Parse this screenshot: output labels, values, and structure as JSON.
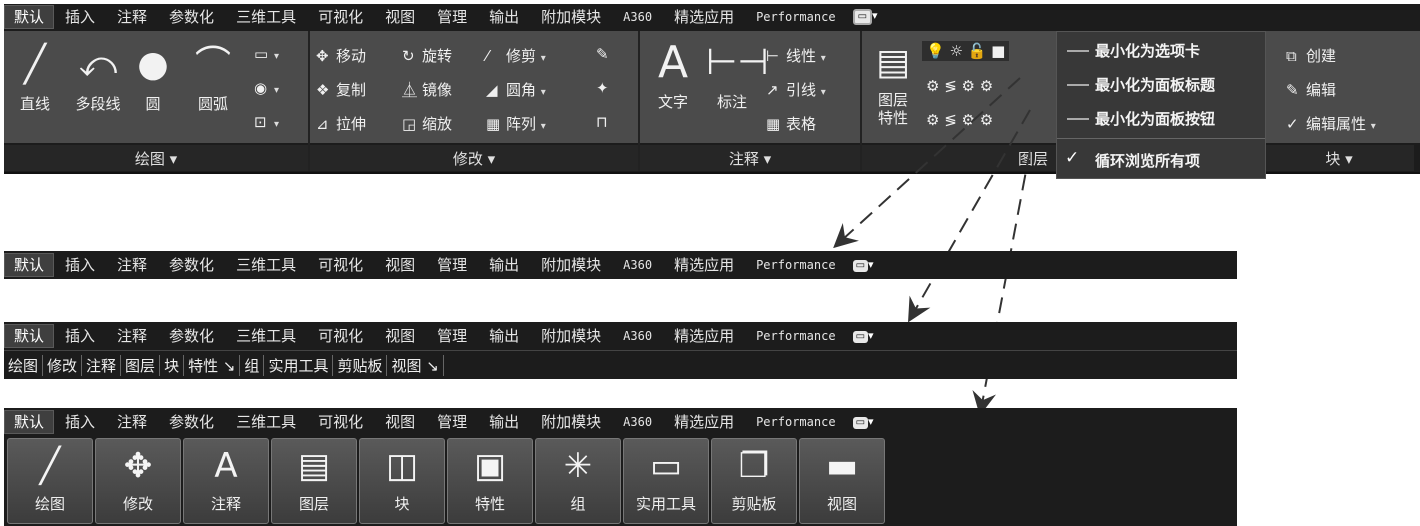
{
  "tabs": [
    "默认",
    "插入",
    "注释",
    "参数化",
    "三维工具",
    "可视化",
    "视图",
    "管理",
    "输出",
    "附加模块",
    "A360",
    "精选应用",
    "Performance"
  ],
  "menu_items": [
    "最小化为选项卡",
    "最小化为面板标题",
    "最小化为面板按钮",
    "循环浏览所有项"
  ],
  "menu_checked_icon": "✓",
  "draw": {
    "title": "绘图 ▾",
    "line": "直线",
    "polyline": "多段线",
    "circle": "圆",
    "arc": "圆弧"
  },
  "modify": {
    "title": "修改 ▾",
    "move": "移动",
    "rotate": "旋转",
    "trim": "修剪",
    "copy": "复制",
    "mirror": "镜像",
    "fillet": "圆角",
    "stretch": "拉伸",
    "scale": "缩放",
    "array": "阵列"
  },
  "annotate": {
    "title": "注释 ▾",
    "text": "文字",
    "dim": "标注",
    "linear": "线性",
    "leader": "引线",
    "table": "表格"
  },
  "layers": {
    "title": "图层",
    "props": "图层\n特性"
  },
  "block": {
    "title": "块 ▾",
    "create": "创建",
    "edit": "编辑",
    "editattr": "编辑属性"
  },
  "panel_titles": [
    "绘图",
    "修改",
    "注释",
    "图层",
    "块",
    "特性 ↘",
    "组",
    "实用工具",
    "剪贴板",
    "视图 ↘"
  ],
  "tiles": [
    "绘图",
    "修改",
    "注释",
    "图层",
    "块",
    "特性",
    "组",
    "实用工具",
    "剪贴板",
    "视图"
  ],
  "tile_icons": [
    "╱",
    "✥",
    "A",
    "▤",
    "◫",
    "▣",
    "✳",
    "▭",
    "❐",
    "▬"
  ]
}
